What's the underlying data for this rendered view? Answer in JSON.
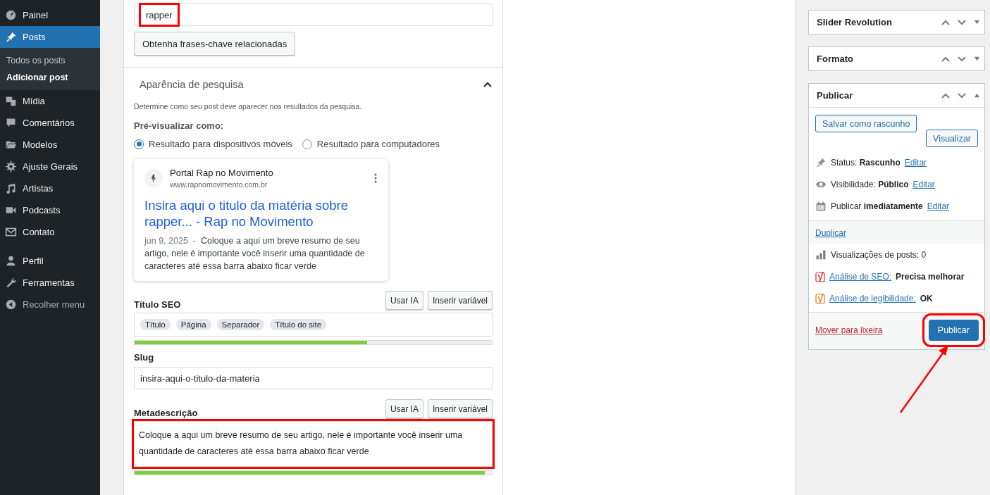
{
  "sidebar": {
    "items": [
      {
        "label": "Painel",
        "selected": false
      },
      {
        "label": "Posts",
        "selected": true,
        "children": [
          {
            "label": "Todos os posts",
            "selected": false
          },
          {
            "label": "Adicionar post",
            "selected": true
          }
        ]
      },
      {
        "label": "Mídia",
        "selected": false
      },
      {
        "label": "Comentários",
        "selected": false
      },
      {
        "label": "Modelos",
        "selected": false
      },
      {
        "label": "Ajuste Gerais",
        "selected": false
      },
      {
        "label": "Artistas",
        "selected": false
      },
      {
        "label": "Podcasts",
        "selected": false
      },
      {
        "label": "Contato",
        "selected": false
      },
      {
        "label": "Perfil",
        "selected": false
      },
      {
        "label": "Ferramentas",
        "selected": false
      },
      {
        "label": "Recolher menu",
        "selected": false
      }
    ]
  },
  "keyphrase": {
    "value": "rapper",
    "highlighted": true,
    "button": "Obtenha frases-chave relacionadas"
  },
  "search_appearance": {
    "title": "Aparência de pesquisa",
    "description": "Determine como seu post deve aparecer nos resultados da pesquisa.",
    "preview_label": "Pré-visualizar como:",
    "options": [
      {
        "label": "Resultado para dispositivos móveis",
        "selected": true
      },
      {
        "label": "Resultado para computadores",
        "selected": false
      }
    ],
    "preview": {
      "site_name": "Portal Rap no Movimento",
      "url": "www.rapnomovimento.com.br",
      "title": "Insira aqui o titulo da matéria sobre rapper... - Rap no Movimento",
      "date": "jun 9, 2025",
      "separator": "-",
      "snippet": "Coloque a aqui um breve resumo de seu artigo, nele é importante você inserir uma quantidade de caracteres até essa barra abaixo ficar verde"
    },
    "seo_title": {
      "label": "Título SEO",
      "buttons": [
        "Usar IA",
        "Inserir variável"
      ],
      "tags": [
        "Título",
        "Página",
        "Separador",
        "Título do site"
      ],
      "level": 0.65
    },
    "slug": {
      "label": "Slug",
      "value": "insira-aqui-o-titulo-da-materia"
    },
    "meta_description": {
      "label": "Metadescrição",
      "buttons": [
        "Usar IA",
        "Inserir variável"
      ],
      "value": "Coloque a aqui um breve resumo de seu artigo, nele é importante você inserir uma quantidade de caracteres até essa barra abaixo ficar verde",
      "highlighted": true,
      "level": 0.98
    }
  },
  "side_boxes": [
    {
      "title": "Slider Revolution",
      "expanded": false
    },
    {
      "title": "Formato",
      "expanded": false
    }
  ],
  "publish": {
    "title": "Publicar",
    "expanded": true,
    "save_draft": "Salvar como rascunho",
    "preview": "Visualizar",
    "meta": [
      {
        "label": "Status:",
        "value": "Rascunho",
        "link": "Editar"
      },
      {
        "label": "Visibilidade:",
        "value": "Público",
        "link": "Editar"
      },
      {
        "label": "Publicar",
        "value": "imediatamente",
        "link": "Editar"
      }
    ],
    "duplicate": "Duplicar",
    "views": "Visualizações de posts: 0",
    "analysis": [
      {
        "link": "Análise de SEO:",
        "value": "Precisa melhorar",
        "color": "#dc3232"
      },
      {
        "link": "Análise de legibilidade:",
        "value": "OK",
        "color": "#ee7c1b"
      }
    ],
    "trash": "Mover para lixeira",
    "publish_button": "Publicar",
    "highlighted": true
  }
}
